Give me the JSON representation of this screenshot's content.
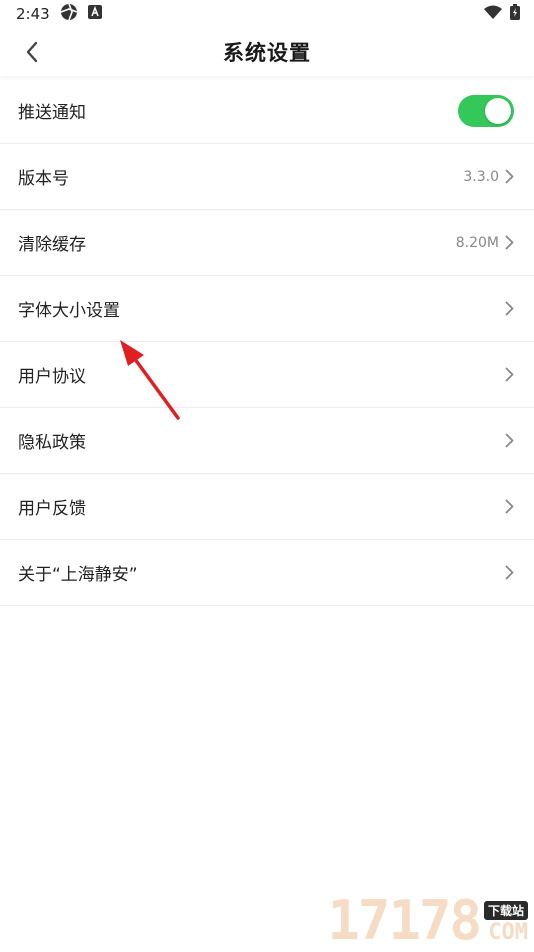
{
  "status_bar": {
    "time": "2:43"
  },
  "header": {
    "title": "系统设置"
  },
  "settings": [
    {
      "label": "推送通知",
      "type": "toggle",
      "on": true
    },
    {
      "label": "版本号",
      "type": "value",
      "value": "3.3.0"
    },
    {
      "label": "清除缓存",
      "type": "value",
      "value": "8.20M"
    },
    {
      "label": "字体大小设置",
      "type": "link"
    },
    {
      "label": "用户协议",
      "type": "link"
    },
    {
      "label": "隐私政策",
      "type": "link"
    },
    {
      "label": "用户反馈",
      "type": "link"
    },
    {
      "label": "关于“上海静安”",
      "type": "link"
    }
  ],
  "watermark": {
    "number": "17178",
    "tag": "下载站",
    "suffix": "COM"
  },
  "colors": {
    "toggle_on": "#34c759",
    "annotation_arrow": "#e02020"
  }
}
